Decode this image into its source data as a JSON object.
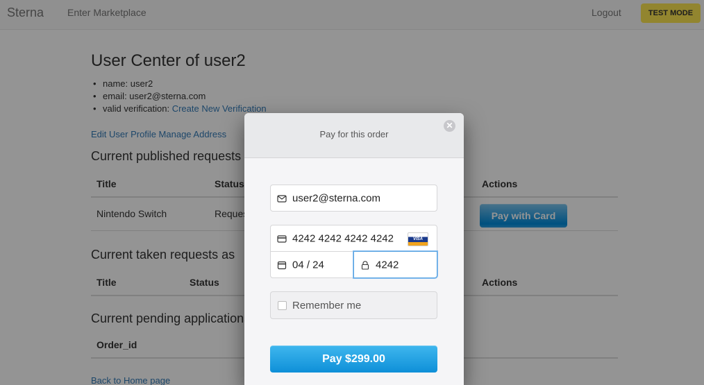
{
  "navbar": {
    "brand": "Sterna",
    "marketplace_link": "Enter Marketplace",
    "logout_link": "Logout",
    "test_mode_badge": "TEST MODE"
  },
  "page": {
    "title": "User Center of user2",
    "info": {
      "name": "name: user2",
      "email": "email: user2@sterna.com",
      "verification_label": "valid verification: ",
      "verification_link": "Create New Verification"
    },
    "profile_links": {
      "edit_profile": "Edit User Profile",
      "manage_address": "Manage Address"
    },
    "published_section": {
      "heading": "Current published requests",
      "headers": [
        "Title",
        "Status",
        "Actions"
      ],
      "rows": [
        {
          "title": "Nintendo Switch",
          "status": "Requested",
          "action": "Pay with Card"
        }
      ]
    },
    "taken_section": {
      "heading": "Current taken requests as",
      "headers": [
        "Title",
        "Status",
        "Actions"
      ]
    },
    "pending_section": {
      "heading": "Current pending applications",
      "headers": [
        "Order_id"
      ]
    },
    "back_link": "Back to Home page"
  },
  "checkout": {
    "title": "Pay for this order",
    "close_symbol": "✕",
    "email_value": "user2@sterna.com",
    "card_number": "4242 4242 4242 4242",
    "card_brand": "VISA",
    "expiry": "04 / 24",
    "cvc": "4242",
    "remember_label": "Remember me",
    "pay_button": "Pay $299.00"
  },
  "colors": {
    "link": "#337ab7",
    "test_mode_bg": "#fbe552",
    "pay_button": "#1a9fe3",
    "focus_border": "#5aa4e0"
  }
}
